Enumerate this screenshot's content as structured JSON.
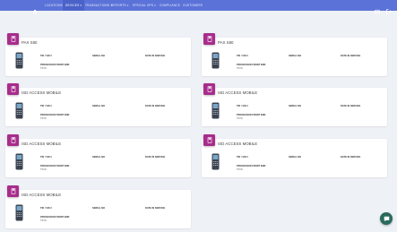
{
  "nav": {
    "items": [
      {
        "label": "LOCATIONS ▾",
        "active": false
      },
      {
        "label": "DEVICES ▾",
        "active": true
      },
      {
        "label": "TRANSACTIONS ▾",
        "active": false
      },
      {
        "label": "REPORTS ▾",
        "active": false
      },
      {
        "label": "SPECIAL OPS ▾",
        "active": false
      },
      {
        "label": "COMPLIANCE",
        "active": false
      },
      {
        "label": "CUSTOMERS",
        "active": false
      }
    ]
  },
  "field_labels": {
    "tid": "TID / VID #",
    "serial": "SERIAL NO",
    "date": "DATE IN SERVICE",
    "processor": "PROCESSOR FRONT END"
  },
  "cards": [
    {
      "title": "PAX S80",
      "type_value": "TSYS"
    },
    {
      "title": "PAX S80",
      "type_value": "TSYS"
    },
    {
      "title": "ISD ACCESS MOBILE",
      "type_value": "TSYS"
    },
    {
      "title": "ISD ACCESS MOBILE",
      "type_value": "TSYS"
    },
    {
      "title": "ISD ACCESS MOBILE",
      "type_value": "TSYS"
    },
    {
      "title": "ISD ACCESS MOBILE",
      "type_value": "TSYS"
    },
    {
      "title": "ISD ACCESS MOBILE",
      "type_value": "TSYS"
    }
  ],
  "colors": {
    "topbar": "#5b73d8",
    "badge": "#a82c8c",
    "chat_fab": "#2a6a5c"
  },
  "icons": {
    "home": "home-icon",
    "settings": "settings-icon",
    "logout": "logout-icon",
    "badge": "pos-terminal-icon",
    "chat": "chat-icon"
  }
}
